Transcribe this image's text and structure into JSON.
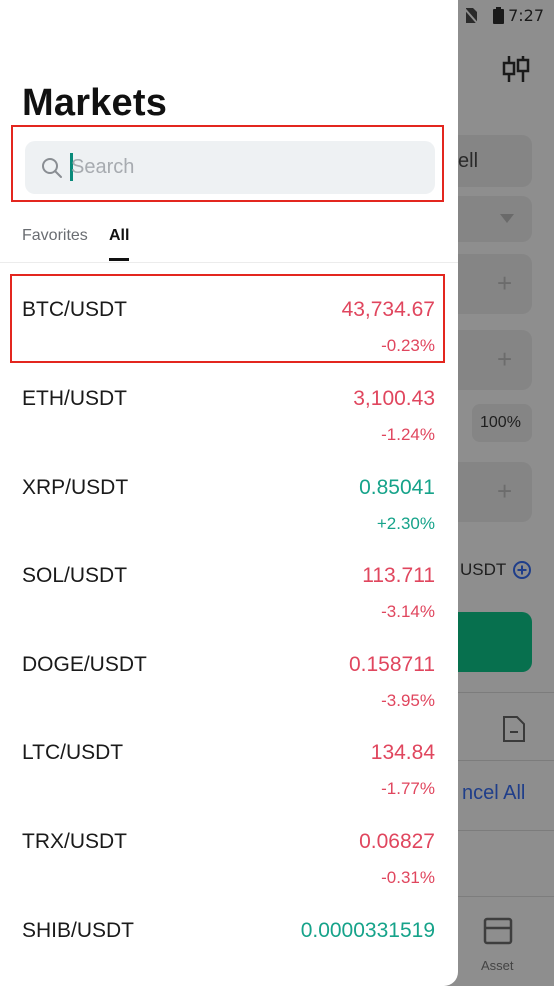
{
  "status_bar": {
    "time": "7:27"
  },
  "background": {
    "sell_tab_fragment": "ell",
    "percent_label": "100%",
    "usdt_fragment": "USDT",
    "cancel_all_fragment": "ncel All",
    "nav_asset_label": "Asset"
  },
  "drawer": {
    "title": "Markets",
    "search": {
      "placeholder": "Search",
      "value": ""
    },
    "tabs": [
      {
        "label": "Favorites",
        "active": false
      },
      {
        "label": "All",
        "active": true
      }
    ],
    "markets": [
      {
        "pair": "BTC/USDT",
        "price": "43,734.67",
        "change": "-0.23%",
        "trend": "down"
      },
      {
        "pair": "ETH/USDT",
        "price": "3,100.43",
        "change": "-1.24%",
        "trend": "down"
      },
      {
        "pair": "XRP/USDT",
        "price": "0.85041",
        "change": "+2.30%",
        "trend": "up"
      },
      {
        "pair": "SOL/USDT",
        "price": "113.711",
        "change": "-3.14%",
        "trend": "down"
      },
      {
        "pair": "DOGE/USDT",
        "price": "0.158711",
        "change": "-3.95%",
        "trend": "down"
      },
      {
        "pair": "LTC/USDT",
        "price": "134.84",
        "change": "-1.77%",
        "trend": "down"
      },
      {
        "pair": "TRX/USDT",
        "price": "0.06827",
        "change": "-0.31%",
        "trend": "down"
      },
      {
        "pair": "SHIB/USDT",
        "price": "0.0000331519",
        "change": "",
        "trend": "up"
      }
    ]
  },
  "colors": {
    "down": "#e0465e",
    "up": "#16a38a",
    "highlight": "#e3261f"
  },
  "icons": [
    "search-icon",
    "candlestick-icon",
    "wifi-icon",
    "no-sim-icon",
    "battery-icon",
    "dropdown-icon",
    "plus-icon",
    "add-circle-icon",
    "order-doc-icon",
    "asset-nav-icon"
  ]
}
